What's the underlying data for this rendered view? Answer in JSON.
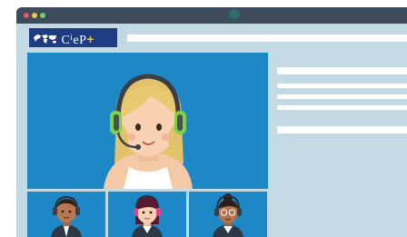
{
  "window": {
    "controls": [
      "close-dot",
      "minimize-dot",
      "maximize-dot"
    ]
  },
  "brand": {
    "logo_text": "C",
    "logo_text_rest": "eP",
    "logo_plus": "+",
    "logo_colors": {
      "background": "#1f3c82",
      "plus": "#f6c417"
    }
  },
  "video": {
    "main_participant": "woman-with-headset",
    "participants": [
      "man-with-headset",
      "woman-with-headset-purple",
      "woman-with-headset-glasses"
    ],
    "background_color": "#1e88c7"
  },
  "colors": {
    "titlebar": "#3d4b5c",
    "window_body": "#c3d9e3",
    "accent_green": "#7fd14a"
  }
}
